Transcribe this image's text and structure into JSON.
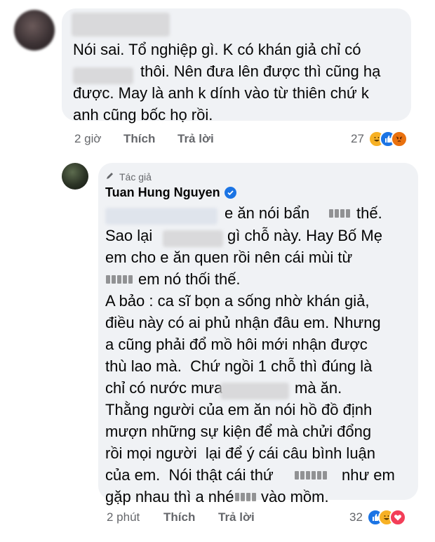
{
  "comment1": {
    "lines": [
      "Nói sai. Tổ nghiệp gì. K có khán giả chỉ có",
      "thôi. Nên đưa lên được thì cũng hạ",
      "được. May là anh k dính vào từ thiên chứ k",
      "anh cũng bốc họ rồi."
    ],
    "time": "2 giờ",
    "like_label": "Thích",
    "reply_label": "Trả lời",
    "reaction_count": "27",
    "reaction_icons": [
      "haha-icon",
      "like-icon",
      "angry-icon"
    ]
  },
  "reply": {
    "author_tag": "Tác giả",
    "author_name": "Tuan Hung Nguyen",
    "lines": [
      "e ăn nói bẩn",
      "thế.",
      "Sao lại",
      "gì chỗ này. Hay Bố Mẹ",
      "em cho e ăn quen rồi nên cái mùi từ",
      "em nó thối thế.",
      "A bảo : ca sĩ bọn a sống nhờ khán giả,",
      "điều này có ai phủ nhận đâu em. Nhưng",
      "a cũng phải đổ mồ hôi mới nhận được",
      "thù lao mà.  Chứ ngồi 1 chỗ thì đúng là",
      "chỉ có nước mưa",
      "mà ăn.",
      "Thằng người của em ăn nói hồ đồ định",
      "mượn những sự kiện để mà chửi đổng",
      "rồi mọi người  lại để ý cái câu bình luận",
      "của em.  Nói thật cái thứ",
      "như em",
      "gặp nhau thì a nhé",
      "vào mồm."
    ],
    "time": "2 phút",
    "like_label": "Thích",
    "reply_label": "Trả lời",
    "reaction_count": "32",
    "reaction_icons": [
      "like-icon",
      "haha-icon",
      "love-icon"
    ]
  },
  "colors": {
    "bubble": "#f0f2f5",
    "meta": "#65676b",
    "like_blue": "#1b74e4",
    "haha": "#f7b125",
    "angry": "#e9710f",
    "love": "#f33e58"
  }
}
